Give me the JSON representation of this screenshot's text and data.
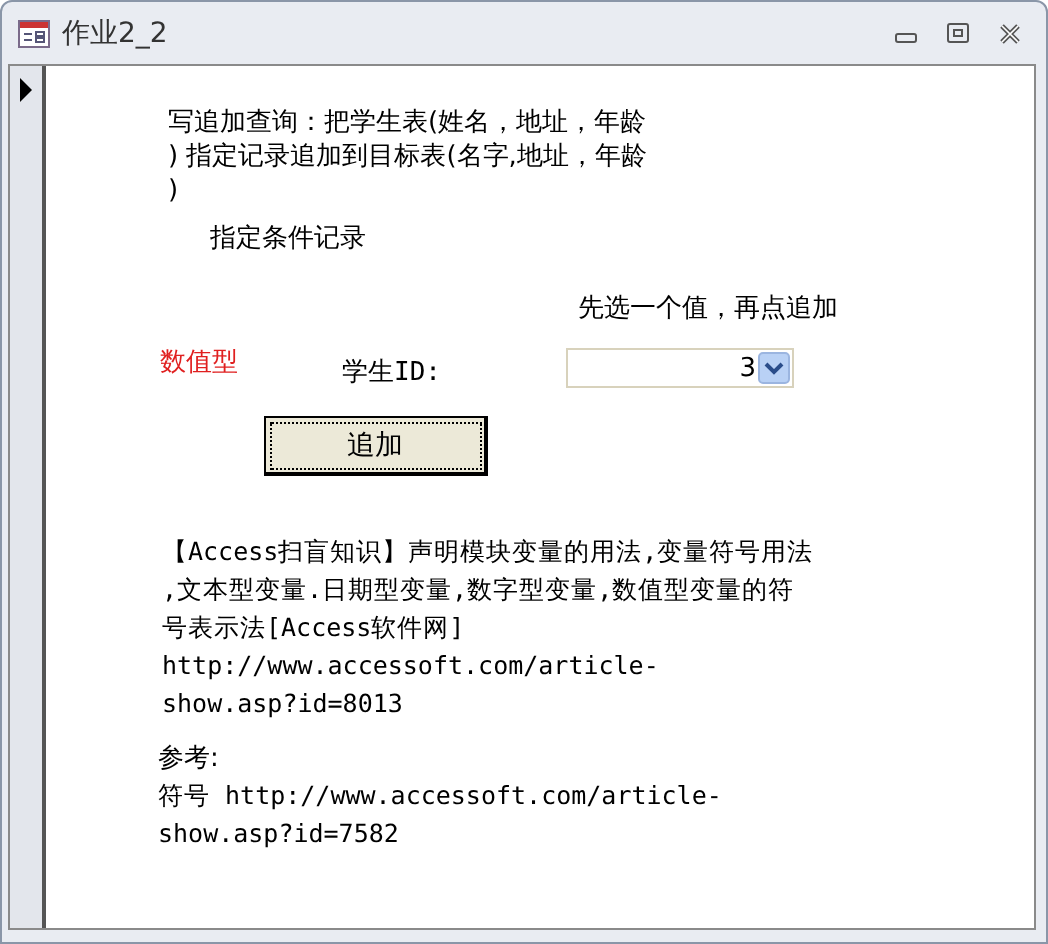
{
  "window": {
    "title": "作业2_2"
  },
  "form": {
    "heading_lines": [
      "写追加查询：把学生表(姓名，地址，年龄",
      ") 指定记录追加到目标表(名字,地址，年龄",
      ")"
    ],
    "subheading": "指定条件记录",
    "hint": "先选一个值，再点追加",
    "type_label": "数值型",
    "field_label": "学生ID:",
    "combo": {
      "value": "3"
    },
    "button": "追加",
    "note_lines": [
      "【Access扫盲知识】声明模块变量的用法,变量符号用法",
      ",文本型变量.日期型变量,数字型变量,数值型变量的符",
      "号表示法[Access软件网]",
      "http://www.accessoft.com/article-",
      "show.asp?id=8013"
    ],
    "reference_label": "参考:",
    "reference_lines": [
      "符号 http://www.accessoft.com/article-",
      "show.asp?id=7582"
    ]
  }
}
